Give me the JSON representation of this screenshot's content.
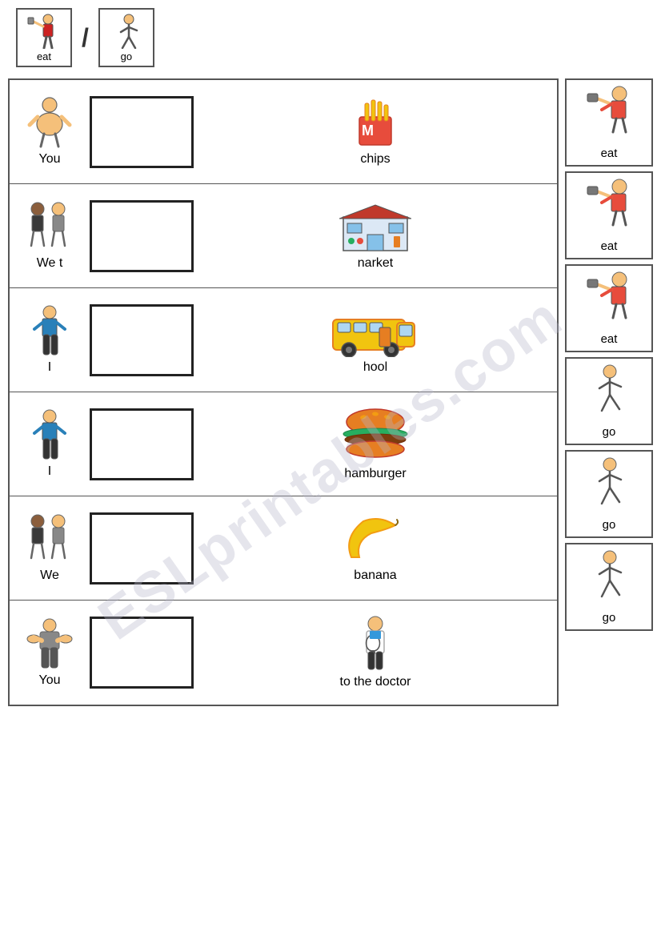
{
  "header": {
    "card1": {
      "label": "eat",
      "icon": "eat"
    },
    "slash": "/",
    "card2": {
      "label": "go",
      "icon": "go"
    }
  },
  "exercises": [
    {
      "subject_label": "You",
      "subject_icon": "fat-person",
      "object_label": "chips",
      "object_icon": "chips",
      "partial_prefix": "",
      "partial_suffix": ""
    },
    {
      "subject_label": "We t",
      "subject_icon": "two-people",
      "object_label": "narket",
      "object_icon": "market",
      "partial_prefix": "We t",
      "partial_suffix": "narket"
    },
    {
      "subject_label": "I",
      "subject_icon": "person-blue",
      "object_label": "hool",
      "object_icon": "school-bus",
      "partial_prefix": "I",
      "partial_suffix": "hool"
    },
    {
      "subject_label": "I",
      "subject_icon": "person-blue2",
      "object_label": "hamburger",
      "object_icon": "hamburger",
      "partial_prefix": "I",
      "partial_suffix": ""
    },
    {
      "subject_label": "We",
      "subject_icon": "two-people2",
      "object_label": "banana",
      "object_icon": "banana",
      "partial_prefix": "We",
      "partial_suffix": ""
    },
    {
      "subject_label": "You",
      "subject_icon": "strong-person",
      "object_label": "to the doctor",
      "object_icon": "doctor",
      "partial_prefix": "You",
      "partial_suffix": ""
    }
  ],
  "word_cards": [
    {
      "label": "eat",
      "icon": "eat-person"
    },
    {
      "label": "eat",
      "icon": "eat-person"
    },
    {
      "label": "eat",
      "icon": "eat-person"
    },
    {
      "label": "go",
      "icon": "go-person"
    },
    {
      "label": "go",
      "icon": "go-person"
    },
    {
      "label": "go",
      "icon": "go-person"
    }
  ],
  "watermark": "ESLprintables.com"
}
